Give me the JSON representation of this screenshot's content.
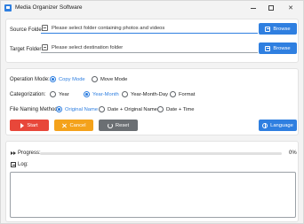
{
  "window": {
    "title": "Media Organizer Software",
    "accent_color": "#2f7fe0",
    "icons": [
      "app-icon",
      "minimize-icon",
      "maximize-icon",
      "close-icon"
    ]
  },
  "paths": {
    "source": {
      "label": "Source Folder:",
      "placeholder": "Please select folder containing photos and videos",
      "value": "",
      "button": "Browse"
    },
    "target": {
      "label": "Target Folder:",
      "placeholder": "Please select destination folder",
      "value": "",
      "button": "Browse"
    }
  },
  "options": {
    "operation_mode": {
      "label": "Operation Mode:",
      "choices": [
        "Copy Mode",
        "Move Mode"
      ],
      "selected": "Copy Mode"
    },
    "categorization": {
      "label": "Categorization:",
      "choices": [
        "Year",
        "Year-Month",
        "Year-Month-Day",
        "Format"
      ],
      "selected": "Year-Month"
    },
    "file_naming": {
      "label": "File Naming Method:",
      "choices": [
        "Original Name",
        "Date + Original Name",
        "Date + Time"
      ],
      "selected": "Original Name"
    }
  },
  "actions": {
    "start": "Start",
    "cancel": "Cancel",
    "reset": "Reset",
    "language": "Language",
    "colors": {
      "start": "#e8473a",
      "cancel": "#f4a21b",
      "reset": "#6b6f73",
      "language": "#2f7fe0"
    }
  },
  "progress": {
    "label": "Progress:",
    "value_text": "0%",
    "fraction": 0
  },
  "log": {
    "label": "Log:",
    "content": ""
  }
}
